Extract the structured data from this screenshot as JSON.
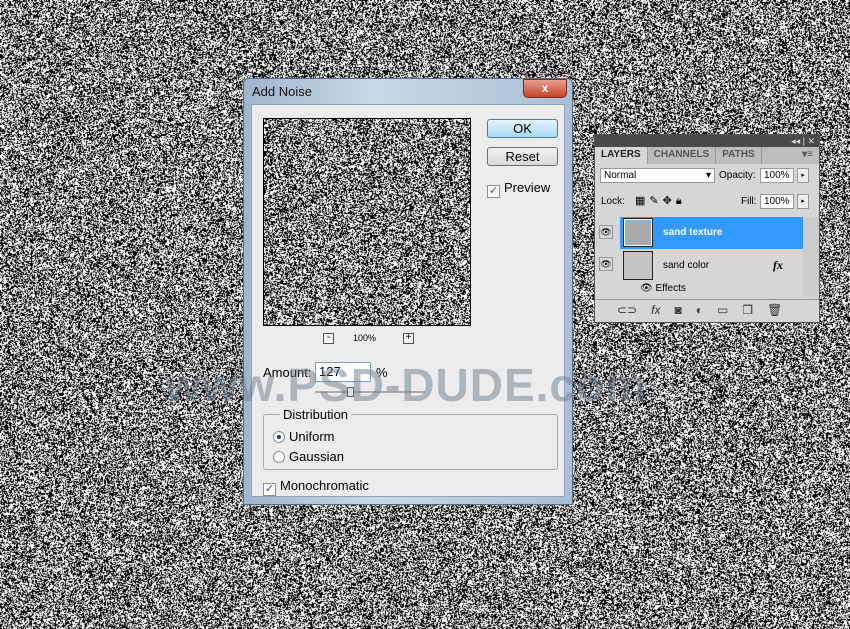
{
  "dialog": {
    "title": "Add Noise",
    "close": "x",
    "ok": "OK",
    "reset": "Reset",
    "preview_label": "Preview",
    "preview_checked": true,
    "zoom_out": "-",
    "zoom_level": "100%",
    "zoom_in": "+",
    "amount_label": "Amount:",
    "amount_value": "127",
    "amount_unit": "%",
    "amount_slider_fraction": 0.32,
    "distribution_label": "Distribution",
    "uniform": "Uniform",
    "gaussian": "Gaussian",
    "selected_distribution": "Uniform",
    "monochromatic": "Monochromatic",
    "monochromatic_checked": true
  },
  "layers_panel": {
    "collapse": "◂◂ | ✕",
    "tabs": [
      "LAYERS",
      "CHANNELS",
      "PATHS"
    ],
    "menu": "▾≡",
    "blend_mode": "Normal",
    "opacity_label": "Opacity:",
    "opacity": "100%",
    "lock_label": "Lock:",
    "fill_label": "Fill:",
    "fill": "100%",
    "layers": [
      {
        "name": "sand texture",
        "selected": true,
        "visible": true
      },
      {
        "name": "sand color",
        "selected": false,
        "visible": true,
        "fx": "fx"
      }
    ],
    "effects_label": "Effects",
    "selected_color": "#3399ff"
  },
  "watermark": "www.PSD-DUDE.com"
}
